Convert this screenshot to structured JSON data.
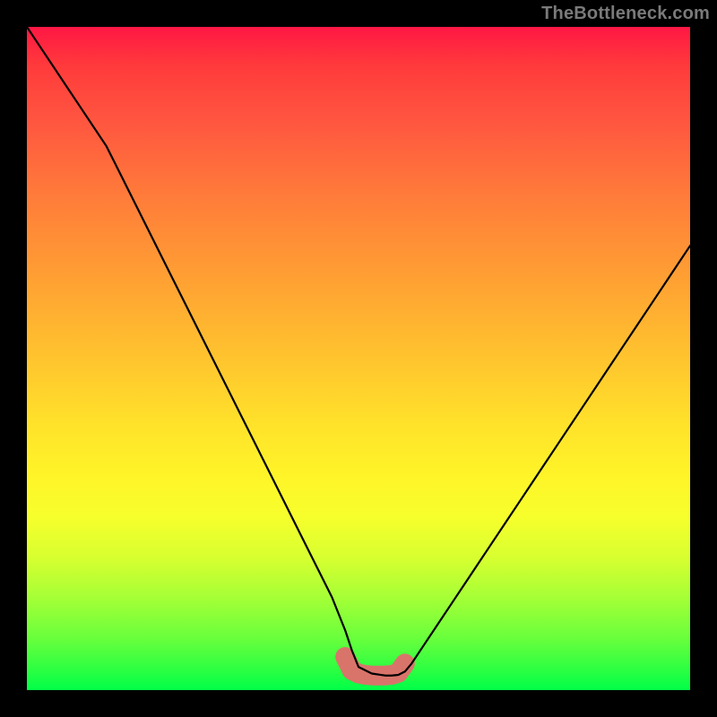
{
  "watermark": "TheBottleneck.com",
  "chart_data": {
    "type": "line",
    "title": "",
    "xlabel": "",
    "ylabel": "",
    "xlim": [
      0,
      100
    ],
    "ylim": [
      0,
      100
    ],
    "grid": false,
    "legend": false,
    "background_gradient": {
      "top": "#ff1744",
      "bottom": "#00ff48"
    },
    "series": [
      {
        "name": "curve",
        "x": [
          0,
          2,
          4,
          6,
          8,
          10,
          12,
          14,
          16,
          18,
          20,
          22,
          24,
          26,
          28,
          30,
          32,
          34,
          36,
          38,
          40,
          42,
          44,
          46,
          48,
          49,
          50,
          52,
          54,
          55,
          56,
          57,
          58,
          60,
          62,
          64,
          66,
          68,
          70,
          72,
          74,
          76,
          78,
          80,
          82,
          84,
          86,
          88,
          90,
          92,
          94,
          96,
          98,
          100
        ],
        "values": [
          100,
          97,
          94,
          91,
          88,
          85,
          82,
          78,
          74,
          70,
          66,
          62,
          58,
          54,
          50,
          46,
          42,
          38,
          34,
          30,
          26,
          22,
          18,
          14,
          9,
          6,
          3.5,
          2.5,
          2.2,
          2.2,
          2.3,
          2.8,
          4,
          7,
          10,
          13,
          16,
          19,
          22,
          25,
          28,
          31,
          34,
          37,
          40,
          43,
          46,
          49,
          52,
          55,
          58,
          61,
          64,
          67
        ],
        "color": "#000000",
        "stroke_width": 2
      },
      {
        "name": "highlight-band",
        "x": [
          48,
          49,
          50,
          51,
          52,
          53,
          54,
          55,
          56,
          57
        ],
        "values": [
          5.0,
          3.0,
          2.5,
          2.3,
          2.2,
          2.2,
          2.2,
          2.3,
          2.6,
          4.0
        ],
        "color": "#d9746b",
        "stroke_width": 12
      }
    ]
  }
}
